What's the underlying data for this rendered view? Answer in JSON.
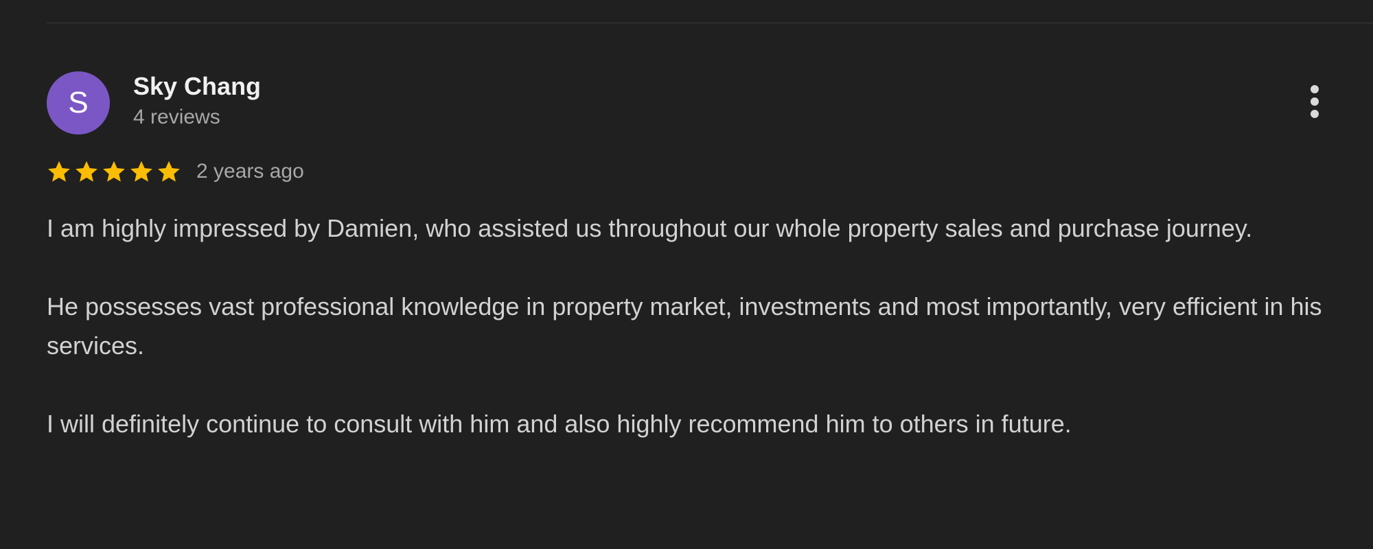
{
  "colors": {
    "background": "#202020",
    "avatar_bg": "#7b57c6",
    "star": "#fbbc04",
    "name": "#f1f1f1",
    "muted": "#a8a8a8",
    "body": "#d2d2d2"
  },
  "reviewer": {
    "avatar_initial": "S",
    "name": "Sky Chang",
    "review_count": "4 reviews"
  },
  "rating": {
    "stars": 5,
    "max": 5,
    "age": "2 years ago"
  },
  "review": {
    "paragraphs": [
      "I am highly impressed by Damien, who assisted us throughout our whole property sales and purchase journey.",
      "He possesses vast professional knowledge in property market, investments and most importantly, very efficient in his services.",
      "I will definitely continue to consult with him and also highly recommend him to others in future."
    ]
  },
  "icons": {
    "more": "more-vert-icon",
    "star": "star-icon"
  }
}
